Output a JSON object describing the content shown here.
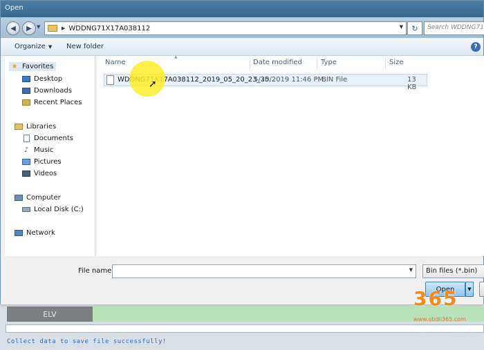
{
  "window": {
    "title": "Open"
  },
  "address": {
    "path": "WDDNG71X17A038112",
    "search_placeholder": "Search WDDNG71"
  },
  "toolbar": {
    "organize_label": "Organize",
    "new_folder_label": "New folder"
  },
  "nav": {
    "favorites_label": "Favorites",
    "favorites": [
      "Desktop",
      "Downloads",
      "Recent Places"
    ],
    "libraries_label": "Libraries",
    "libraries": [
      "Documents",
      "Music",
      "Pictures",
      "Videos"
    ],
    "computer_label": "Computer",
    "computer": [
      "Local Disk (C:)"
    ],
    "network_label": "Network"
  },
  "columns": {
    "name": "Name",
    "date": "Date modified",
    "type": "Type",
    "size": "Size"
  },
  "files": [
    {
      "name": "WDDNG71X17A038112_2019_05_20_23_35...",
      "date": "5/20/2019 11:46 PM",
      "type": "BIN File",
      "size": "13 KB"
    }
  ],
  "bottom": {
    "filename_label": "File name:",
    "filename_value": "",
    "filetype_value": "Bin files (*.bin)",
    "open_label": "Open"
  },
  "background_app": {
    "elv_label": "ELV",
    "status_text": "Collect data to save file successfully!"
  },
  "watermark": {
    "logo": "365",
    "url": "www.obdii365.com"
  },
  "colors": {
    "titlebar": "#37688f",
    "highlight": "#ffec28",
    "status_text": "#2e6fb5",
    "watermark": "#f08a1a"
  }
}
